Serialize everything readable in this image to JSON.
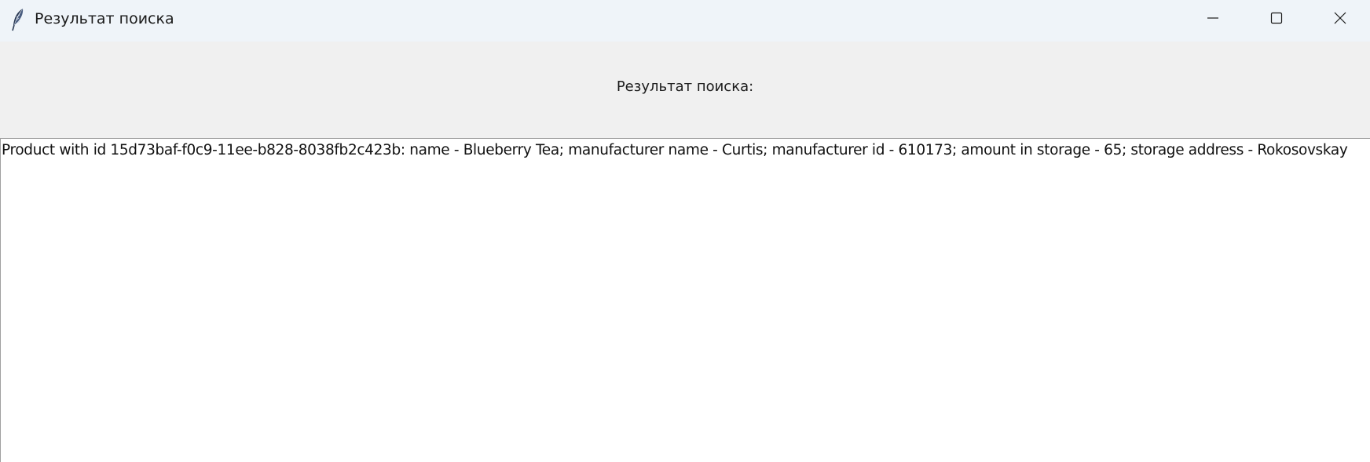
{
  "window": {
    "title": "Результат поиска",
    "app_icon": "feather-icon",
    "controls": {
      "minimize_icon": "minimize-icon",
      "maximize_icon": "maximize-icon",
      "close_icon": "close-icon"
    }
  },
  "header": {
    "label": "Результат поиска:"
  },
  "results": {
    "lines": [
      "Product with id 15d73baf-f0c9-11ee-b828-8038fb2c423b: name - Blueberry Tea; manufacturer name - Curtis; manufacturer id - 610173; amount in storage - 65; storage address - Rokosovskay"
    ]
  }
}
